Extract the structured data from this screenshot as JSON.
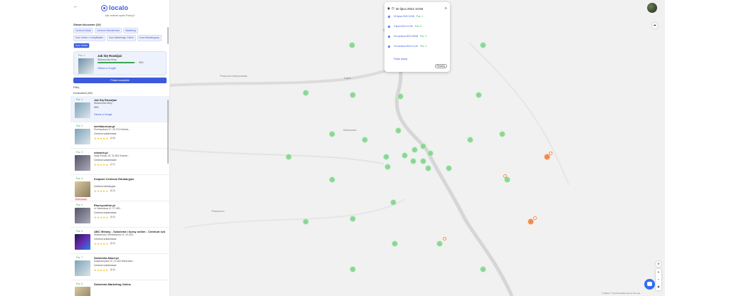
{
  "sidebar": {
    "back_icon": "arrow-left-icon",
    "logo_text": "localo",
    "question": "Jak zmienić rynek Polscy?",
    "sections": {
      "keywords_title": "Słowa kluczowe (10)",
      "filters_title": "Filtry",
      "competitors_title": "Konkurenci (50)",
      "show_all_button": "Pokaż wszystkie"
    },
    "chips": [
      {
        "label": "Centrum Nauki",
        "active": false
      },
      {
        "label": "Centrum Szkoleniowe",
        "active": false
      },
      {
        "label": "Marketing",
        "active": false
      },
      {
        "label": "Kurs Online z Certyfikatem",
        "active": false
      },
      {
        "label": "Kurs Marketingu Online",
        "active": false
      },
      {
        "label": "Kurs Marketingowy",
        "active": false
      },
      {
        "label": "Kurs Online",
        "active": true
      }
    ],
    "featured": {
      "pos_label": "Poz. 1",
      "name": "Jak Się Rozwijać",
      "visibility_label": "Widoczność firmy",
      "visibility_pct": "95%",
      "visibility_value": 0.95,
      "link": "Otwórz w Google"
    },
    "competitors": [
      {
        "pos_label": "Poz. 1",
        "name": "Jak Się Rozwijać",
        "addr": "Widoczność firmy",
        "cat": "95%",
        "stars": "",
        "rating": "",
        "link": "Otwórz w Google",
        "type": "featured"
      },
      {
        "pos_label": "Poz. 2",
        "name": "strefakursow.pl",
        "addr": "Przemysłowa 37, 30-701 Kraków...",
        "cat": "Centrum szkoleniowe",
        "stars": "★★★★★",
        "rating": "(4.6)",
        "type": "normal"
      },
      {
        "pos_label": "Poz. 3",
        "name": "eduweb.pl",
        "addr": "Aleja Pokoju 18, 31-564 Kraków...",
        "cat": "Centrum szkoleniowe",
        "stars": "★★★★★",
        "rating": "(4.7)",
        "type": "normal"
      },
      {
        "pos_label": "Poz. 4",
        "name": "Krajowe Centrum Edukacyjne",
        "addr": "",
        "cat": "Centrum edukacyjne",
        "stars": "★★★★★",
        "rating": "(5.0)",
        "type": "promo",
        "promo": "Promowane"
      },
      {
        "pos_label": "Poz. 5",
        "name": "Ekursyonline.pl",
        "addr": "ul. Warszawa 12, 27-400...",
        "cat": "Centrum szkoleniowe",
        "stars": "★★★★★",
        "rating": "(5.0)",
        "type": "normal"
      },
      {
        "pos_label": "Poz. 6",
        "name": "ABC Wiedzy - Szkolenia i kursy online - Centrum szkoleń",
        "addr": "Wiadomości Sienkiewicza 14, 03-300...",
        "cat": "Centrum szkoleniowe",
        "stars": "★★★★★",
        "rating": "(5.0)",
        "type": "normal"
      },
      {
        "pos_label": "Poz. 7",
        "name": "Szkolenia-Nauri.pl",
        "addr": "Świętokrzyska 22, 21-300 Warszawa...",
        "cat": "Centrum szkoleniowe",
        "stars": "★★★★★",
        "rating": "(5.0)",
        "type": "normal"
      },
      {
        "pos_label": "Poz. 8",
        "name": "Szkolenia Marketing Online",
        "addr": "",
        "cat": "",
        "stars": "",
        "rating": "",
        "type": "normal"
      }
    ]
  },
  "map": {
    "popup": {
      "date_title": "30 lipca 2024 10:58",
      "entries": [
        {
          "date": "02 lipca 2024 10:58",
          "tag": "Poz. 1"
        },
        {
          "date": "3 lipca 2024 11:05",
          "tag": "Poz. 5"
        },
        {
          "date": "26 czerwca 2024 09:58",
          "tag": "Poz. 2"
        },
        {
          "date": "15 czerwca 2024 11:26",
          "tag": "Poz. 2"
        }
      ],
      "show_more": "Pokaż więcej",
      "reset_button": "Resetuj"
    },
    "labels": {
      "city1": "Puszcza Kampinoska",
      "city2": "Ząbki",
      "city3": "Warszawa",
      "city4": "Piaseczno"
    },
    "attribution": "© Mapbox © OpenStreetMap Improve this map",
    "zoom_in": "+",
    "zoom_out": "−",
    "icons": {
      "share": "share-icon",
      "locate": "target-icon",
      "chat": "chat-icon"
    }
  }
}
